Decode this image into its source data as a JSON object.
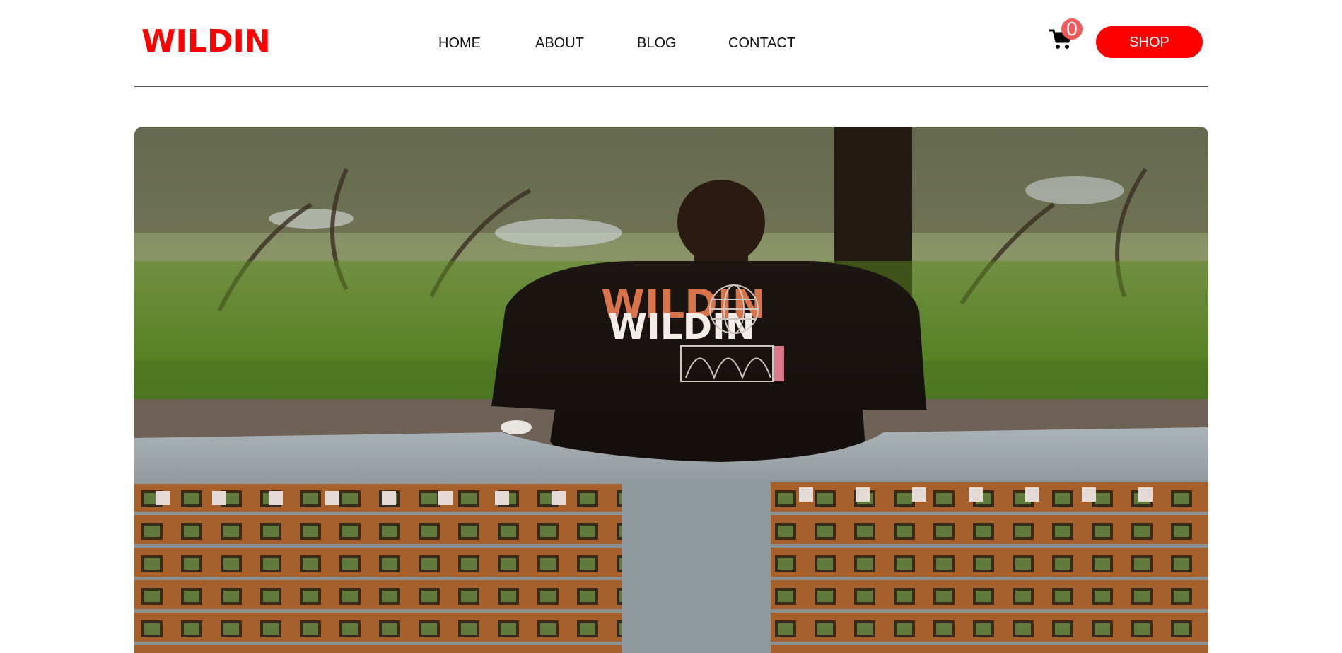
{
  "brand": {
    "logo_text": "WILDIN",
    "color": "#ff0000"
  },
  "nav": {
    "items": [
      {
        "label": "HOME"
      },
      {
        "label": "ABOUT"
      },
      {
        "label": "BLOG"
      },
      {
        "label": "CONTACT"
      }
    ]
  },
  "cart": {
    "icon": "cart-icon",
    "count": "0"
  },
  "shop_button": {
    "label": "SHOP"
  },
  "hero": {
    "image": "photo of a person in a black WILDIN t-shirt sitting on a wall, seen from behind, trees in background",
    "shirt_print": "WILDIN"
  }
}
